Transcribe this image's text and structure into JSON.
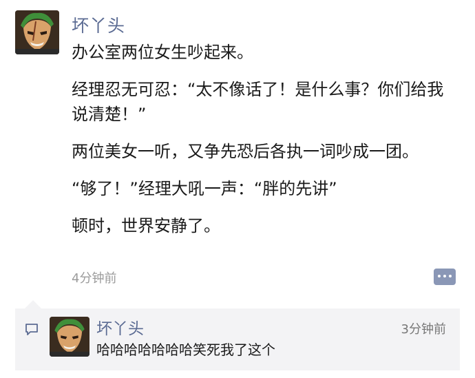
{
  "post": {
    "author": "坏丫头",
    "avatar_icon": "anime-character-avatar",
    "paragraphs": [
      "办公室两位女生吵起来。",
      "经理忍无可忍：“太不像话了！是什么事？你们给我说清楚！”",
      "两位美女一听，又争先恐后各执一词吵成一团。",
      "“够了！”经理大吼一声：“胖的先讲”",
      "顿时，世界安静了。"
    ],
    "time": "4分钟前",
    "action_icon": "comment-dots-icon"
  },
  "comments": [
    {
      "author": "坏丫头",
      "time": "3分钟前",
      "text": "哈哈哈哈哈哈哈笑死我了这个"
    }
  ],
  "colors": {
    "name_link": "#5b6b93",
    "comment_bg": "#f3f3f5",
    "action_button": "#8a97b6"
  }
}
